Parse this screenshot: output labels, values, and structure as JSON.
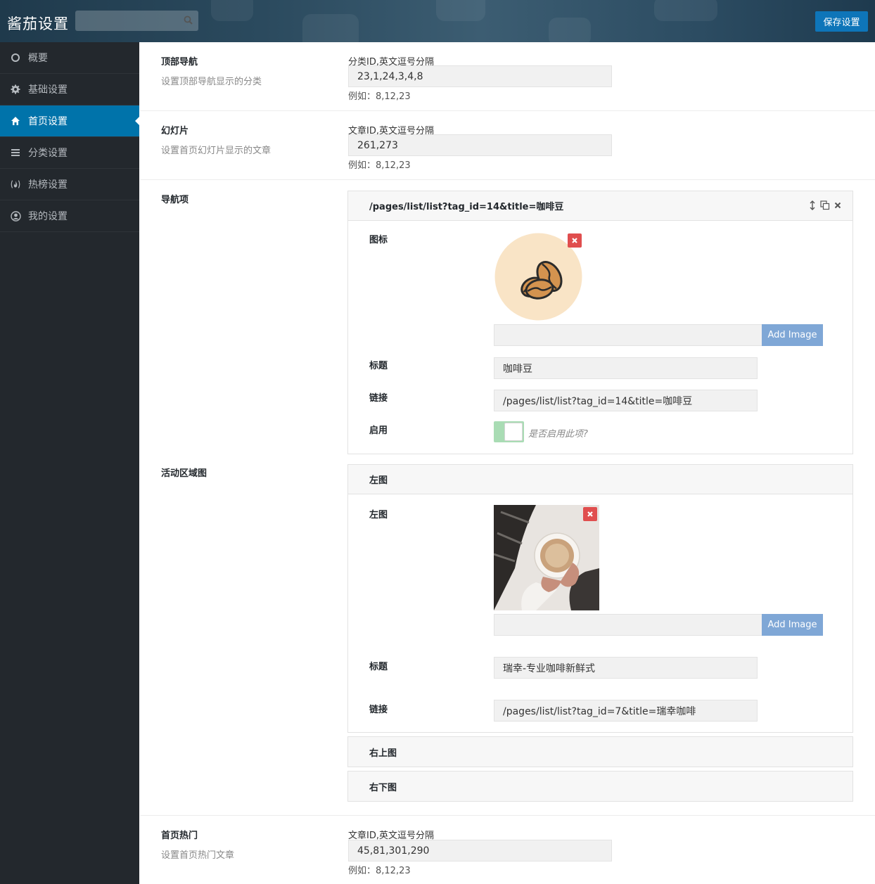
{
  "header": {
    "title": "酱茄设置",
    "search_placeholder": "",
    "save_label": "保存设置"
  },
  "sidebar": {
    "items": [
      {
        "label": "概要",
        "icon": "circle-icon"
      },
      {
        "label": "基础设置",
        "icon": "gear-icon"
      },
      {
        "label": "首页设置",
        "icon": "home-icon",
        "active": true
      },
      {
        "label": "分类设置",
        "icon": "list-icon"
      },
      {
        "label": "热榜设置",
        "icon": "fire-icon"
      },
      {
        "label": "我的设置",
        "icon": "user-circle-icon"
      }
    ]
  },
  "sections": {
    "top_nav": {
      "title": "顶部导航",
      "desc": "设置顶部导航显示的分类",
      "label": "分类ID,英文逗号分隔",
      "value": "23,1,24,3,4,8",
      "hint": "例如：8,12,23"
    },
    "slides": {
      "title": "幻灯片",
      "desc": "设置首页幻灯片显示的文章",
      "label": "文章ID,英文逗号分隔",
      "value": "261,273",
      "hint": "例如：8,12,23"
    },
    "nav_items": {
      "title": "导航项",
      "item_header": "/pages/list/list?tag_id=14&title=咖啡豆",
      "icon_label": "图标",
      "add_image": "Add Image",
      "title_label": "标题",
      "title_value": "咖啡豆",
      "link_label": "链接",
      "link_value": "/pages/list/list?tag_id=14&title=咖啡豆",
      "enable_label": "启用",
      "enable_note": "是否启用此项?",
      "enabled": true
    },
    "activity": {
      "title": "活动区域图",
      "left_header": "左图",
      "left_label": "左图",
      "add_image": "Add Image",
      "title_label": "标题",
      "title_value": "瑞幸-专业咖啡新鲜式",
      "link_label": "链接",
      "link_value": "/pages/list/list?tag_id=7&title=瑞幸咖啡",
      "top_right_header": "右上图",
      "bottom_right_header": "右下图"
    },
    "hot": {
      "title": "首页热门",
      "desc": "设置首页热门文章",
      "label": "文章ID,英文逗号分隔",
      "value": "45,81,301,290",
      "hint": "例如：8,12,23"
    }
  },
  "colors": {
    "sidebar_bg": "#23282d",
    "active_blue": "#0073aa",
    "save_blue": "#0e75b9",
    "add_image_blue": "#7fa7d6",
    "remove_red": "#e04e4e",
    "toggle_green": "#a9dcb4"
  }
}
